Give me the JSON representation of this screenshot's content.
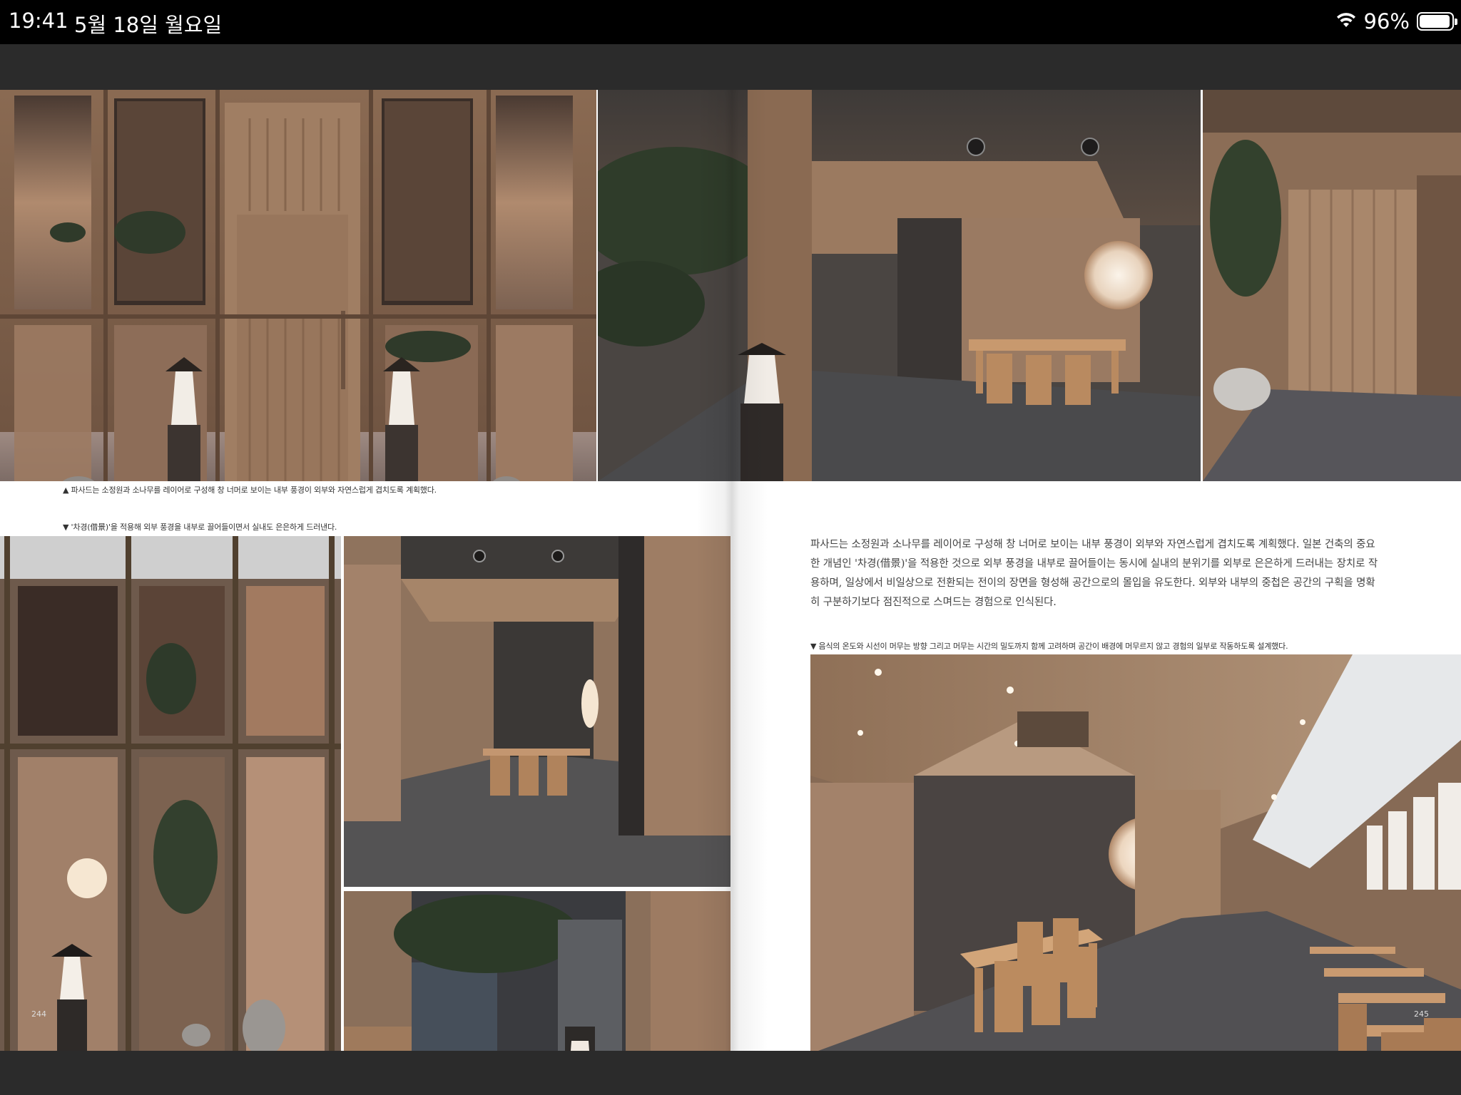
{
  "status_bar": {
    "time": "19:41",
    "date": "5월 18일 월요일",
    "battery_percent": "96%",
    "battery_level": 0.96,
    "wifi_icon": "wifi-icon",
    "battery_icon": "battery-icon"
  },
  "magazine": {
    "left_page": {
      "caption_top": "▲ 파사드는 소정원과 소나무를 레이어로 구성해 창 너머로 보이는 내부 풍경이 외부와 자연스럽게 겹치도록 계획했다.",
      "caption_middle": "▼ '차경(借景)'을 적용해 외부 풍경을 내부로 끌어들이면서 실내도 은은하게 드러낸다.",
      "page_number": "244"
    },
    "right_page": {
      "body_lines": [
        "파사드는 소정원과 소나무를 레이어로 구성해 창 너머로 보이는 내부 풍경이 외부와 자연스럽게 겹치도록 계획했다. 일본 건축의 중요",
        "한 개념인 '차경(借景)'을 적용한 것으로 외부 풍경을 내부로 끌어들이는 동시에 실내의 분위기를 외부로 은은하게 드러내는 장치로 작",
        "용하며, 일상에서 비일상으로 전환되는 전이의 장면을 형성해 공간으로의 몰입을 유도한다. 외부와 내부의 중첩은 공간의 구획을 명확",
        "히 구분하기보다 점진적으로 스며드는 경험으로 인식된다."
      ],
      "caption": "▼ 음식의 온도와 시선이 머무는 방향 그리고 머무는 시간의 밀도까지 함께 고려하며 공간이 배경에 머무르지 않고 경험의 일부로 작동하도록 설계했다.",
      "page_number": "245"
    }
  }
}
